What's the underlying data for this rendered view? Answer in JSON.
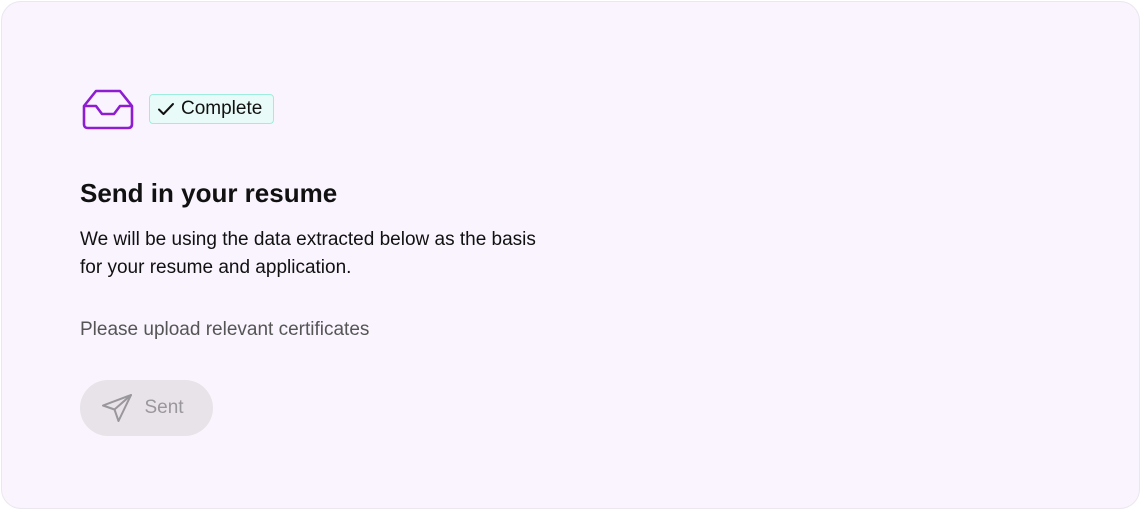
{
  "status_badge": {
    "label": "Complete",
    "icon": "check-icon",
    "border_color": "#9eeedd",
    "background_color": "#e9fbf8"
  },
  "header": {
    "icon": "inbox-icon",
    "icon_color": "#8e1cd1"
  },
  "content": {
    "title": "Send in your resume",
    "description": "We will be using the data extracted below as the basis for your resume and application.",
    "note": "Please upload relevant certificates"
  },
  "send_button": {
    "label": "Sent",
    "icon": "paper-plane-icon",
    "state": "disabled"
  },
  "colors": {
    "card_background": "#faf4fe",
    "button_background": "#e7e3e9",
    "button_text": "#9a979c"
  }
}
